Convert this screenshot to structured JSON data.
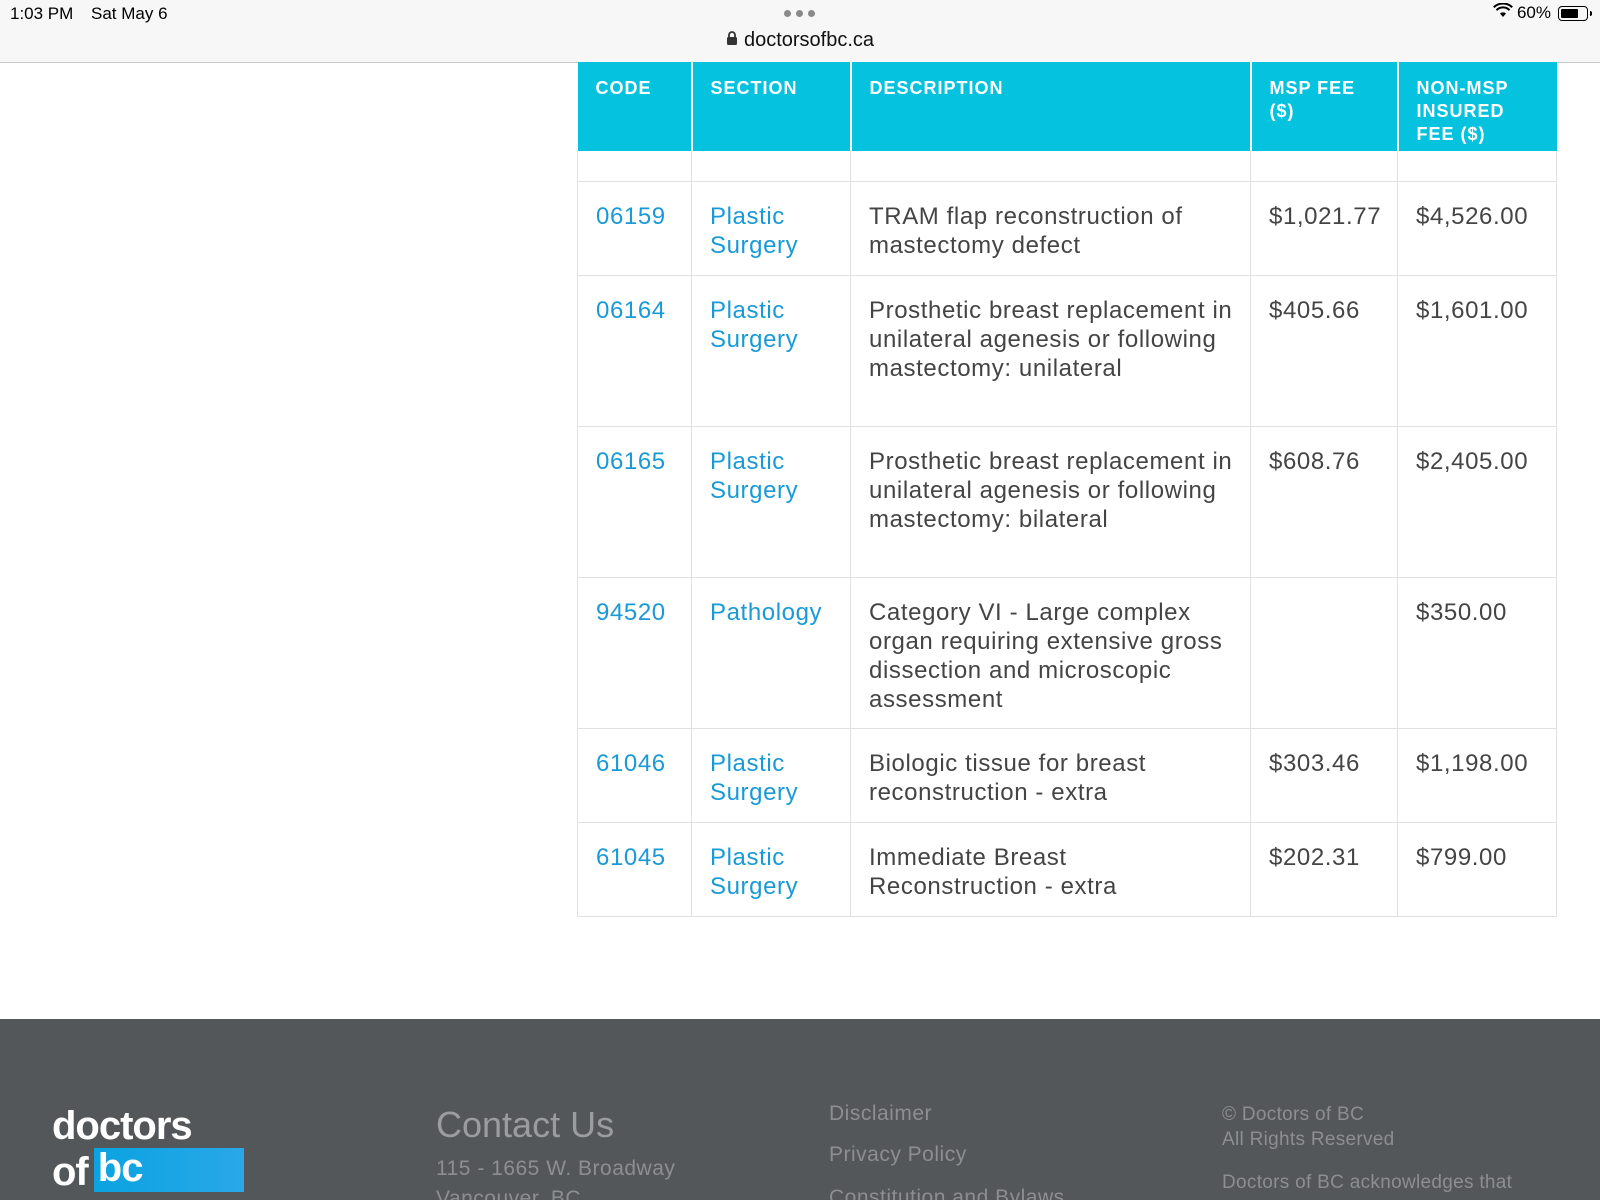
{
  "status_bar": {
    "time": "1:03 PM",
    "date": "Sat May 6",
    "url": "doctorsofbc.ca",
    "battery": "60%",
    "battery_level": 0.6
  },
  "table": {
    "headers": {
      "code": "CODE",
      "section": "SECTION",
      "description": "DESCRIPTION",
      "msp_fee": "MSP FEE ($)",
      "non_msp_fee": "NON-MSP INSURED FEE ($)"
    },
    "rows": [
      {
        "code": "06159",
        "section": "Plastic Surgery",
        "description": "TRAM flap reconstruction of mastectomy defect",
        "msp_fee": "$1,021.77",
        "non_msp_fee": "$4,526.00"
      },
      {
        "code": "06164",
        "section": "Plastic Surgery",
        "description": "Prosthetic breast replacement in unilateral agenesis or following mastectomy: unilateral",
        "msp_fee": "$405.66",
        "non_msp_fee": "$1,601.00"
      },
      {
        "code": "06165",
        "section": "Plastic Surgery",
        "description": "Prosthetic breast replacement in unilateral agenesis or following mastectomy: bilateral",
        "msp_fee": "$608.76",
        "non_msp_fee": "$2,405.00"
      },
      {
        "code": "94520",
        "section": "Pathology",
        "description": "Category VI - Large complex organ requiring extensive gross dissection and microscopic assessment",
        "msp_fee": "",
        "non_msp_fee": "$350.00"
      },
      {
        "code": "61046",
        "section": "Plastic Surgery",
        "description": "Biologic tissue for breast reconstruction - extra",
        "msp_fee": "$303.46",
        "non_msp_fee": "$1,198.00"
      },
      {
        "code": "61045",
        "section": "Plastic Surgery",
        "description": "Immediate Breast Reconstruction - extra",
        "msp_fee": "$202.31",
        "non_msp_fee": "$799.00"
      }
    ]
  },
  "footer": {
    "logo_line1": "doctors",
    "logo_line2_of": "of",
    "logo_line2_bc": "bc",
    "contact_title": "Contact Us",
    "address_line1": "115 - 1665 W. Broadway",
    "address_line2": "Vancouver, BC",
    "links": [
      "Disclaimer",
      "Privacy Policy",
      "Constitution and Bylaws"
    ],
    "copyright_line1": "© Doctors of BC",
    "copyright_line2": "All Rights Reserved",
    "acknowledgement": "Doctors of BC acknowledges that"
  }
}
